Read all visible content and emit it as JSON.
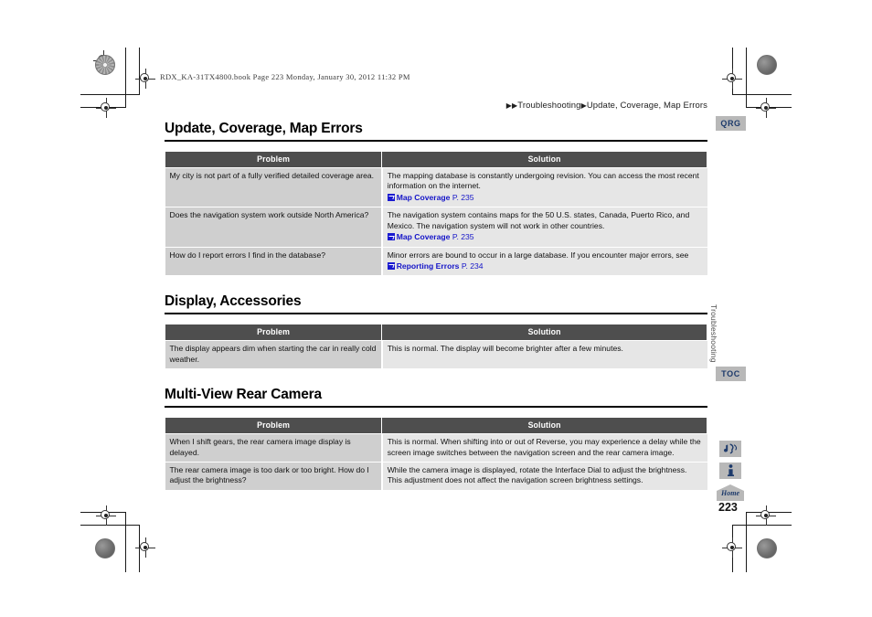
{
  "file_header": "RDX_KA-31TX4800.book  Page 223  Monday, January 30, 2012  11:32 PM",
  "breadcrumb": {
    "arrow1": "▶",
    "arrow2": "▶",
    "parent": "Troubleshooting",
    "arrow3": "▶",
    "current": "Update, Coverage, Map Errors"
  },
  "sections": [
    {
      "title": "Update, Coverage, Map Errors",
      "columns": [
        "Problem",
        "Solution"
      ],
      "rows": [
        {
          "problem": "My city is not part of a fully verified detailed coverage area.",
          "solution": "The mapping database is constantly undergoing revision. You can access the most recent information on the internet.",
          "ref_name": "Map Coverage",
          "ref_page": "P. 235"
        },
        {
          "problem": "Does the navigation system work outside North America?",
          "solution": "The navigation system contains maps for the 50 U.S. states, Canada, Puerto Rico, and Mexico. The navigation system will not work in other countries.",
          "ref_name": "Map Coverage",
          "ref_page": "P. 235"
        },
        {
          "problem": "How do I report errors I find in the database?",
          "solution": "Minor errors are bound to occur in a large database. If you encounter major errors, see",
          "ref_name": "Reporting Errors",
          "ref_page": "P. 234"
        }
      ]
    },
    {
      "title": "Display, Accessories",
      "columns": [
        "Problem",
        "Solution"
      ],
      "rows": [
        {
          "problem": "The display appears dim when starting the car in really cold weather.",
          "solution": "This is normal. The display will become brighter after a few minutes.",
          "ref_name": "",
          "ref_page": ""
        }
      ]
    },
    {
      "title": "Multi-View Rear Camera",
      "columns": [
        "Problem",
        "Solution"
      ],
      "rows": [
        {
          "problem": "When I shift gears, the rear camera image display is delayed.",
          "solution": "This is normal. When shifting into or out of Reverse, you may experience a delay while the screen image switches between the navigation screen and the rear camera image.",
          "ref_name": "",
          "ref_page": ""
        },
        {
          "problem": "The rear camera image is too dark or too bright. How do I adjust the brightness?",
          "solution": "While the camera image is displayed, rotate the Interface Dial to adjust the brightness. This adjustment does not affect the navigation screen brightness settings.",
          "ref_name": "",
          "ref_page": ""
        }
      ]
    }
  ],
  "sidebar": {
    "qrg_label": "QRG",
    "toc_label": "TOC",
    "voice_icon": "voice-command-icon",
    "info_icon": "information-icon",
    "home_icon": "home-icon",
    "home_label": "Home",
    "vertical_label": "Troubleshooting",
    "page_number": "223"
  },
  "colors": {
    "table_header_bg": "#4e4e4e",
    "problem_cell_bg": "#cfcfcf",
    "solution_cell_bg": "#e6e6e6",
    "link_blue": "#1414c8",
    "tab_bg": "#b8b8b8",
    "tab_text": "#1d3a6b"
  }
}
